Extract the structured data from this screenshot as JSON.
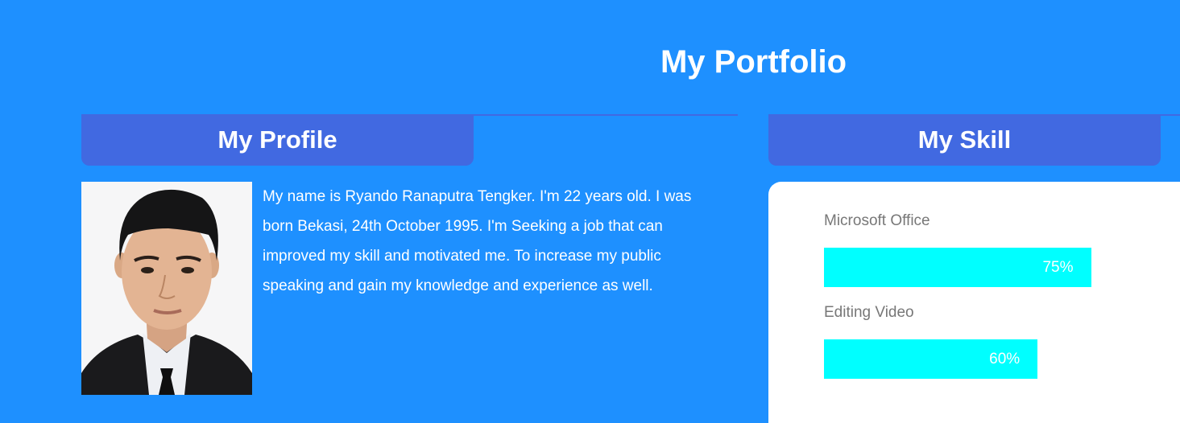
{
  "header": {
    "title": "My Portfolio"
  },
  "profile": {
    "heading": "My Profile",
    "bio": "My name is Ryando Ranaputra Tengker. I'm 22 years old. I was born Bekasi, 24th October 1995. I'm Seeking a job that can improved my skill and motivated me. To increase my public speaking and gain my knowledge and experience as well."
  },
  "skills": {
    "heading": "My Skill",
    "items": [
      {
        "name": "Microsoft Office",
        "level_label": "75%",
        "level": 0.75
      },
      {
        "name": "Editing Video",
        "level_label": "60%",
        "level": 0.6
      }
    ]
  },
  "colors": {
    "page_background": "#1e90ff",
    "header_background": "#4169e1",
    "skill_bar": "#00ffff",
    "card_background": "#ffffff"
  }
}
